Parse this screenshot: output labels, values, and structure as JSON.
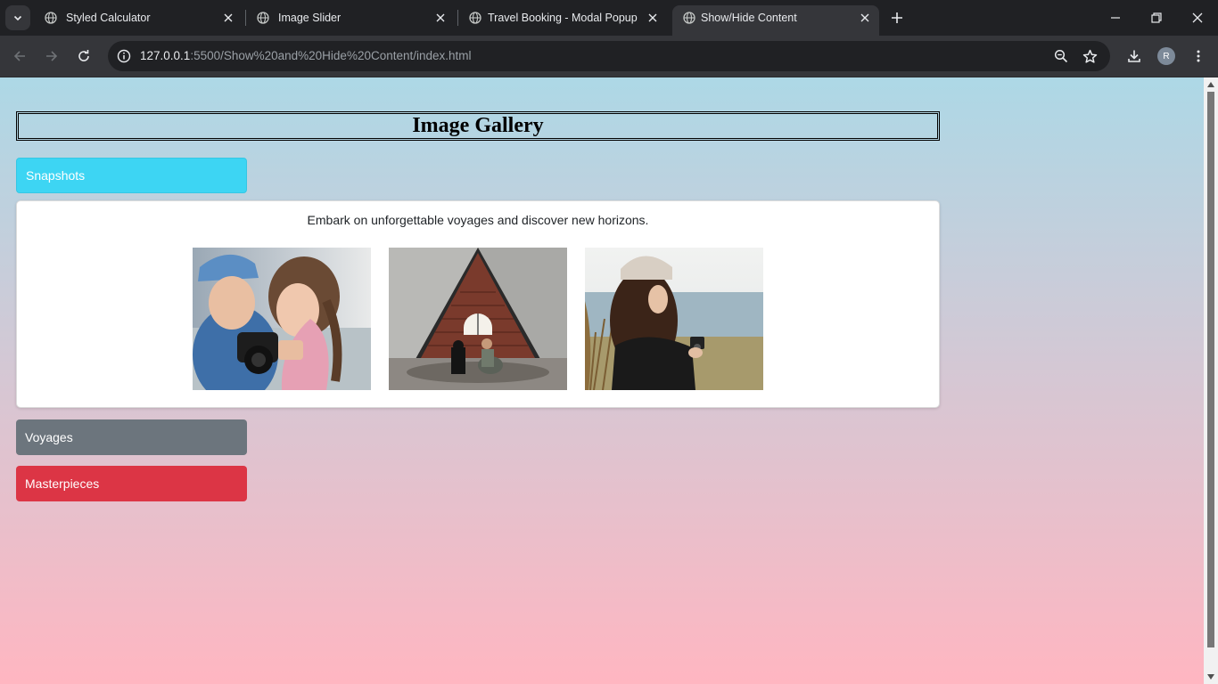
{
  "browser": {
    "tabs": [
      {
        "title": "Styled Calculator",
        "active": false
      },
      {
        "title": "Image Slider",
        "active": false
      },
      {
        "title": "Travel Booking - Modal Popup",
        "active": false
      },
      {
        "title": "Show/Hide Content",
        "active": true
      }
    ],
    "url_host": "127.0.0.1",
    "url_rest": ":5500/Show%20and%20Hide%20Content/index.html",
    "profile_initial": "R"
  },
  "page": {
    "heading": "Image Gallery",
    "sections": {
      "snapshots": {
        "label": "Snapshots",
        "color": "#3dd5f3",
        "expanded": true
      },
      "voyages": {
        "label": "Voyages",
        "color": "#6c757d",
        "expanded": false
      },
      "masterpieces": {
        "label": "Masterpieces",
        "color": "#dc3545",
        "expanded": false
      }
    },
    "panel_text": "Embark on unforgettable voyages and discover new horizons.",
    "images": [
      {
        "alt": "children-with-camera-photo"
      },
      {
        "alt": "attic-photographer-photo"
      },
      {
        "alt": "woman-with-camera-beach-photo"
      }
    ]
  },
  "colors": {
    "gradient_top": "#add8e6",
    "gradient_bottom": "#ffb6c1"
  }
}
